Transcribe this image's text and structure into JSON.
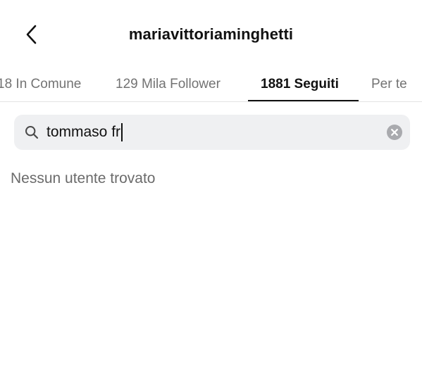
{
  "header": {
    "title": "mariavittoriaminghetti",
    "back_icon": "chevron-left-icon"
  },
  "tabs": [
    {
      "label": "18 In Comune",
      "active": false
    },
    {
      "label": "129 Mila Follower",
      "active": false
    },
    {
      "label": "1881 Seguiti",
      "active": true
    },
    {
      "label": "Per te",
      "active": false
    }
  ],
  "search": {
    "icon": "search-icon",
    "value": "tommaso fr",
    "clear_icon": "clear-icon"
  },
  "results": {
    "empty_message": "Nessun utente trovato"
  },
  "colors": {
    "background": "#ffffff",
    "text_primary": "#111111",
    "text_secondary": "#737373",
    "search_background": "#eff0f2",
    "clear_button": "#a9aaae"
  }
}
